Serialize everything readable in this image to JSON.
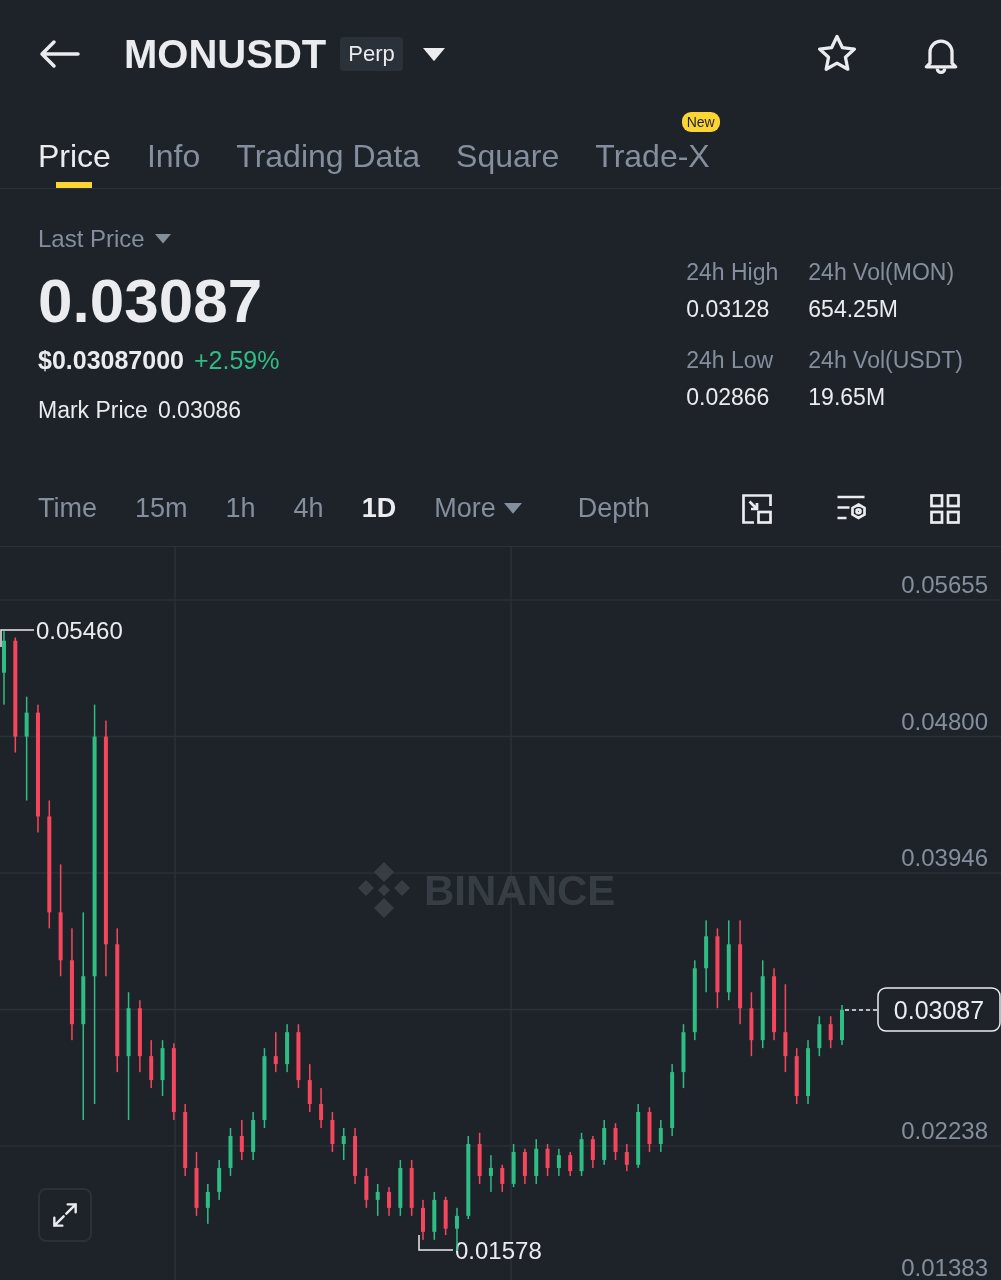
{
  "header": {
    "symbol": "MONUSDT",
    "badge": "Perp"
  },
  "tabs": [
    {
      "label": "Price",
      "selected": true
    },
    {
      "label": "Info",
      "selected": false
    },
    {
      "label": "Trading Data",
      "selected": false
    },
    {
      "label": "Square",
      "selected": false
    },
    {
      "label": "Trade-X",
      "selected": false,
      "badge": "New"
    }
  ],
  "ticker": {
    "price_type": "Last Price",
    "last_price": "0.03087",
    "usd_price": "$0.03087000",
    "change": "+2.59%",
    "mark_label": "Mark Price",
    "mark_price": "0.03086",
    "stats": [
      {
        "label": "24h High",
        "value": "0.03128"
      },
      {
        "label": "24h Vol(MON)",
        "value": "654.25M"
      },
      {
        "label": "24h Low",
        "value": "0.02866"
      },
      {
        "label": "24h Vol(USDT)",
        "value": "19.65M"
      }
    ]
  },
  "intervals": [
    {
      "label": "Time",
      "selected": false,
      "kind": "plain"
    },
    {
      "label": "15m",
      "selected": false,
      "kind": "plain"
    },
    {
      "label": "1h",
      "selected": false,
      "kind": "plain"
    },
    {
      "label": "4h",
      "selected": false,
      "kind": "plain"
    },
    {
      "label": "1D",
      "selected": true,
      "kind": "plain"
    },
    {
      "label": "More",
      "selected": false,
      "kind": "dropdown"
    },
    {
      "label": "Depth",
      "selected": false,
      "kind": "plain"
    }
  ],
  "chart": {
    "watermark": "BINANCE",
    "high_marker": "0.05460",
    "low_marker": "0.01578",
    "current_price": "0.03087",
    "chart_data": {
      "type": "candlestick",
      "grid": true,
      "ylim": [
        0.01383,
        0.05655
      ],
      "yticks": [
        {
          "value": 0.05655,
          "label": "0.05655"
        },
        {
          "value": 0.048,
          "label": "0.04800"
        },
        {
          "value": 0.03946,
          "label": "0.03946"
        },
        {
          "value": 0.02238,
          "label": "0.02238"
        },
        {
          "value": 0.01383,
          "label": "0.01383"
        }
      ],
      "ohlc": [
        [
          0.052,
          0.0546,
          0.05,
          0.054
        ],
        [
          0.054,
          0.0542,
          0.047,
          0.048
        ],
        [
          0.048,
          0.0505,
          0.044,
          0.0495
        ],
        [
          0.0495,
          0.05,
          0.042,
          0.043
        ],
        [
          0.043,
          0.044,
          0.036,
          0.037
        ],
        [
          0.037,
          0.04,
          0.033,
          0.034
        ],
        [
          0.034,
          0.036,
          0.029,
          0.03
        ],
        [
          0.03,
          0.037,
          0.024,
          0.033
        ],
        [
          0.033,
          0.05,
          0.025,
          0.048
        ],
        [
          0.048,
          0.049,
          0.033,
          0.035
        ],
        [
          0.035,
          0.036,
          0.027,
          0.028
        ],
        [
          0.028,
          0.032,
          0.024,
          0.031
        ],
        [
          0.031,
          0.0315,
          0.027,
          0.028
        ],
        [
          0.028,
          0.029,
          0.026,
          0.0265
        ],
        [
          0.0265,
          0.029,
          0.0255,
          0.0285
        ],
        [
          0.0285,
          0.0288,
          0.024,
          0.0245
        ],
        [
          0.0245,
          0.025,
          0.0205,
          0.021
        ],
        [
          0.021,
          0.022,
          0.018,
          0.0185
        ],
        [
          0.0185,
          0.02,
          0.0175,
          0.0195
        ],
        [
          0.0195,
          0.0215,
          0.019,
          0.021
        ],
        [
          0.021,
          0.0235,
          0.0205,
          0.023
        ],
        [
          0.023,
          0.024,
          0.0215,
          0.022
        ],
        [
          0.022,
          0.0245,
          0.0215,
          0.024
        ],
        [
          0.024,
          0.0285,
          0.0235,
          0.028
        ],
        [
          0.028,
          0.0295,
          0.027,
          0.0275
        ],
        [
          0.0275,
          0.03,
          0.027,
          0.0295
        ],
        [
          0.0295,
          0.03,
          0.026,
          0.0265
        ],
        [
          0.0265,
          0.0275,
          0.0245,
          0.025
        ],
        [
          0.025,
          0.026,
          0.0235,
          0.024
        ],
        [
          0.024,
          0.0245,
          0.022,
          0.0225
        ],
        [
          0.0225,
          0.0235,
          0.0215,
          0.023
        ],
        [
          0.023,
          0.0235,
          0.02,
          0.0205
        ],
        [
          0.0205,
          0.021,
          0.0185,
          0.019
        ],
        [
          0.019,
          0.02,
          0.018,
          0.0195
        ],
        [
          0.0195,
          0.0198,
          0.018,
          0.0185
        ],
        [
          0.0185,
          0.0215,
          0.018,
          0.021
        ],
        [
          0.021,
          0.0215,
          0.018,
          0.0185
        ],
        [
          0.0185,
          0.019,
          0.0165,
          0.017
        ],
        [
          0.017,
          0.0195,
          0.0165,
          0.019
        ],
        [
          0.019,
          0.0192,
          0.0168,
          0.0172
        ],
        [
          0.0172,
          0.0185,
          0.0158,
          0.018
        ],
        [
          0.018,
          0.023,
          0.0178,
          0.0225
        ],
        [
          0.0225,
          0.0232,
          0.02,
          0.0205
        ],
        [
          0.0205,
          0.0218,
          0.0195,
          0.021
        ],
        [
          0.021,
          0.0212,
          0.0195,
          0.02
        ],
        [
          0.02,
          0.0225,
          0.0198,
          0.022
        ],
        [
          0.022,
          0.0222,
          0.02,
          0.0205
        ],
        [
          0.0205,
          0.0228,
          0.02,
          0.0222
        ],
        [
          0.0222,
          0.0225,
          0.0205,
          0.021
        ],
        [
          0.021,
          0.0222,
          0.0205,
          0.0218
        ],
        [
          0.0218,
          0.022,
          0.0205,
          0.0208
        ],
        [
          0.0208,
          0.0232,
          0.0205,
          0.0228
        ],
        [
          0.0228,
          0.023,
          0.021,
          0.0215
        ],
        [
          0.0215,
          0.024,
          0.0212,
          0.0235
        ],
        [
          0.0235,
          0.0238,
          0.0215,
          0.022
        ],
        [
          0.022,
          0.0225,
          0.0208,
          0.0212
        ],
        [
          0.0212,
          0.025,
          0.021,
          0.0245
        ],
        [
          0.0245,
          0.0248,
          0.022,
          0.0225
        ],
        [
          0.0225,
          0.024,
          0.022,
          0.0235
        ],
        [
          0.0235,
          0.0275,
          0.023,
          0.027
        ],
        [
          0.027,
          0.03,
          0.026,
          0.0295
        ],
        [
          0.0295,
          0.034,
          0.029,
          0.0335
        ],
        [
          0.0335,
          0.0365,
          0.032,
          0.0355
        ],
        [
          0.0355,
          0.036,
          0.031,
          0.032
        ],
        [
          0.032,
          0.0365,
          0.0315,
          0.035
        ],
        [
          0.035,
          0.0365,
          0.03,
          0.031
        ],
        [
          0.031,
          0.032,
          0.028,
          0.029
        ],
        [
          0.029,
          0.034,
          0.0285,
          0.033
        ],
        [
          0.033,
          0.0335,
          0.029,
          0.0295
        ],
        [
          0.0295,
          0.0325,
          0.027,
          0.028
        ],
        [
          0.028,
          0.0285,
          0.025,
          0.0255
        ],
        [
          0.0255,
          0.029,
          0.025,
          0.0285
        ],
        [
          0.0285,
          0.0305,
          0.028,
          0.03
        ],
        [
          0.03,
          0.0305,
          0.0285,
          0.029
        ],
        [
          0.029,
          0.0312,
          0.0287,
          0.0309
        ]
      ]
    }
  }
}
